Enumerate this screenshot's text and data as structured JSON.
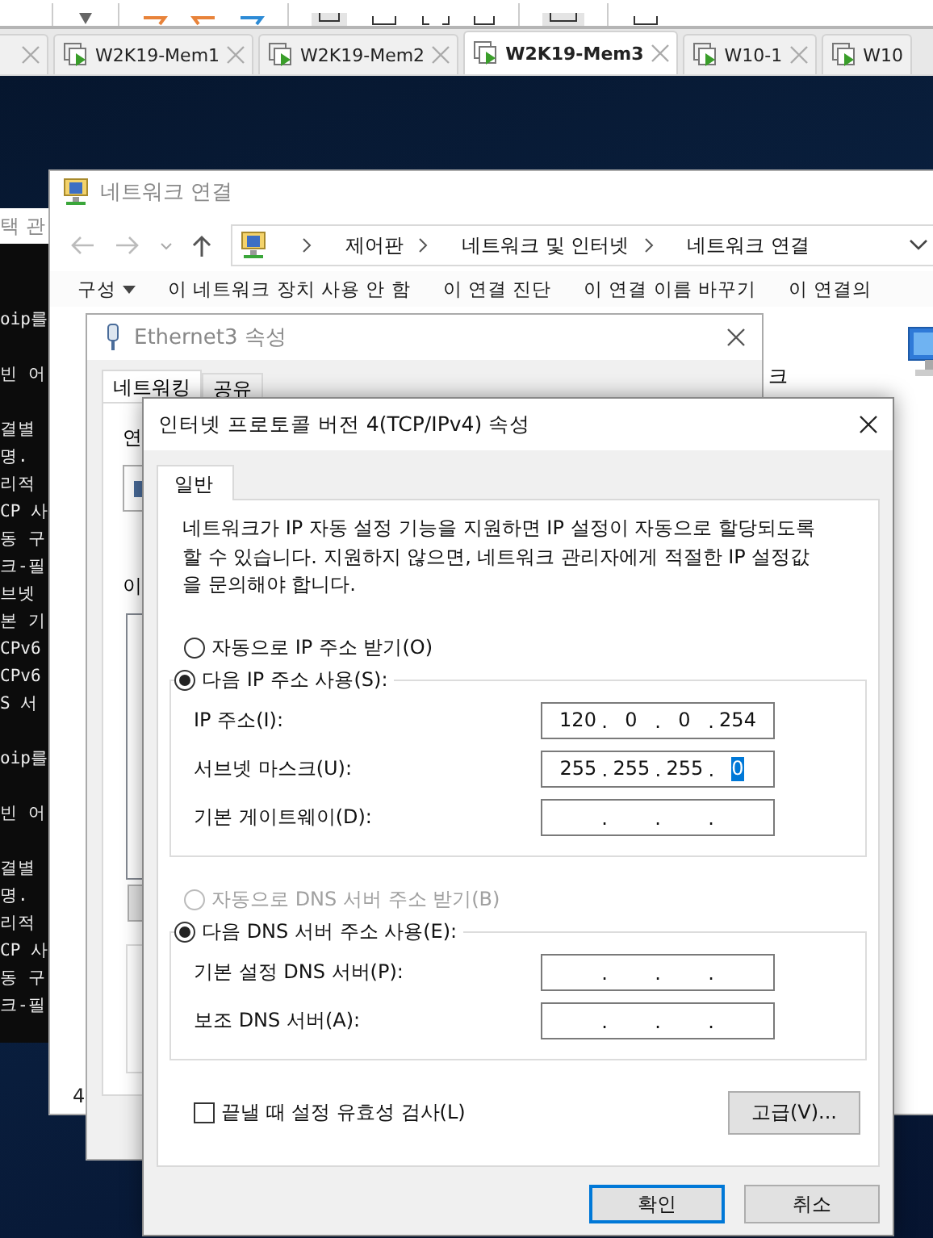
{
  "vm_tabs": [
    {
      "selected": false
    },
    {
      "label": "W2K19-Mem1",
      "selected": false
    },
    {
      "label": "W2K19-Mem2",
      "selected": false
    },
    {
      "label": "W2K19-Mem3",
      "selected": true
    },
    {
      "label": "W10-1",
      "selected": false
    },
    {
      "label": "W10",
      "selected": false
    }
  ],
  "console": {
    "title": "택 관",
    "blocks": [
      [
        "oip를"
      ],
      [
        "빈 어"
      ],
      [
        "결별",
        "명.",
        "리적",
        "CP 사",
        "동 구",
        "크-필",
        "브넷",
        "본 기",
        "CPv6",
        "CPv6",
        "S 서"
      ],
      [
        "oip를"
      ],
      [
        "빈 어"
      ],
      [
        "결별",
        "명.",
        "리적",
        "CP 사",
        "동 구",
        "크-필"
      ]
    ]
  },
  "explorer": {
    "title": "네트워크 연결",
    "breadcrumb": [
      "제어판",
      "네트워크 및 인터넷",
      "네트워크 연결"
    ],
    "commands": [
      {
        "label": "구성",
        "kind": "menu"
      },
      {
        "label": "이 네트워크 장치 사용 안 함",
        "kind": "command"
      },
      {
        "label": "이 연결 진단",
        "kind": "command"
      },
      {
        "label": "이 연결 이름 바꾸기",
        "kind": "command"
      },
      {
        "label": "이 연결의",
        "kind": "command"
      }
    ],
    "item_label": "크",
    "status": "4"
  },
  "ethernet": {
    "title": "Ethernet3 속성",
    "tabs": [
      {
        "label": "네트워킹",
        "selected": true
      },
      {
        "label": "공유",
        "selected": false
      }
    ],
    "labels": [
      "연",
      "이"
    ]
  },
  "ipv4": {
    "title": "인터넷 프로토콜 버전 4(TCP/IPv4) 속성",
    "tabs": [
      {
        "label": "일반",
        "selected": true
      }
    ],
    "description": "네트워크가 IP 자동 설정 기능을 지원하면 IP 설정이 자동으로 할당되도록 할 수 있습니다. 지원하지 않으면, 네트워크 관리자에게 적절한 IP 설정값을 문의해야 합니다.",
    "ip_mode": [
      {
        "label": "자동으로 IP 주소 받기(O)",
        "selected": false,
        "disabled": false
      },
      {
        "label": "다음 IP 주소 사용(S):",
        "selected": true,
        "disabled": false
      }
    ],
    "ip_fields": [
      {
        "label": "IP 주소(I):",
        "separator": ".",
        "octets": [
          {
            "text": "120",
            "selected": false
          },
          {
            "text": "0",
            "selected": false
          },
          {
            "text": "0",
            "selected": false
          },
          {
            "text": "254",
            "selected": false
          }
        ]
      },
      {
        "label": "서브넷 마스크(U):",
        "separator": ".",
        "octets": [
          {
            "text": "255",
            "selected": false
          },
          {
            "text": "255",
            "selected": false
          },
          {
            "text": "255",
            "selected": false
          },
          {
            "text": "0",
            "selected": true
          }
        ]
      },
      {
        "label": "기본 게이트웨이(D):",
        "separator": ".",
        "octets": [
          {
            "selected": false
          },
          {
            "selected": false
          },
          {
            "selected": false
          },
          {
            "selected": false
          }
        ]
      }
    ],
    "dns_mode": [
      {
        "label": "자동으로 DNS 서버 주소 받기(B)",
        "selected": false,
        "disabled": true
      },
      {
        "label": "다음 DNS 서버 주소 사용(E):",
        "selected": true,
        "disabled": false
      }
    ],
    "dns_fields": [
      {
        "label": "기본 설정 DNS 서버(P):",
        "separator": ".",
        "octets": [
          {
            "selected": false
          },
          {
            "selected": false
          },
          {
            "selected": false
          },
          {
            "selected": false
          }
        ]
      },
      {
        "label": "보조 DNS 서버(A):",
        "separator": ".",
        "octets": [
          {
            "selected": false
          },
          {
            "selected": false
          },
          {
            "selected": false
          },
          {
            "selected": false
          }
        ]
      }
    ],
    "validate": {
      "label": "끝낼 때 설정 유효성 검사(L)",
      "checked": false
    },
    "advanced_button": "고급(V)...",
    "buttons": [
      {
        "label": "확인",
        "default": true
      },
      {
        "label": "취소",
        "default": false
      }
    ]
  }
}
